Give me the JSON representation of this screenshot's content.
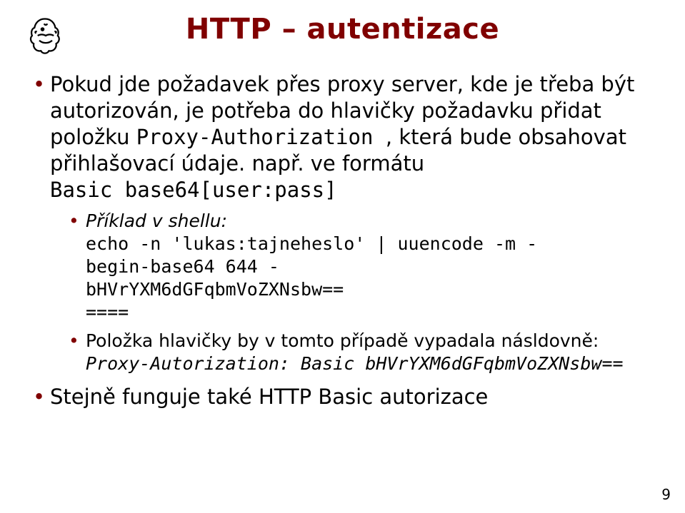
{
  "title": "HTTP – autentizace",
  "bullet1": {
    "pre1": "Pokud jde požadavek přes proxy server, kde je třeba být autorizován, je potřeba do hlavičky požadavku přidat položku ",
    "mono1": "Proxy-Authorization ",
    "mid1": ", která bude obsahovat přihlašovací údaje. např. ve formátu",
    "code1": "Basic base64[user:pass]"
  },
  "sub1": {
    "label": "Příklad v shellu:",
    "code": "echo -n 'lukas:tajneheslo' | uuencode -m -\nbegin-base64 644 -\nbHVrYXM6dGFqbmVoZXNsbw==\n===="
  },
  "sub2": {
    "text": "Položka hlavičky by v tomto případě vypadala násldovně:",
    "code": "Proxy-Autorization: Basic bHVrYXM6dGFqbmVoZXNsbw=="
  },
  "bullet2": "Stejně funguje také HTTP Basic autorizace",
  "page_number": "9"
}
